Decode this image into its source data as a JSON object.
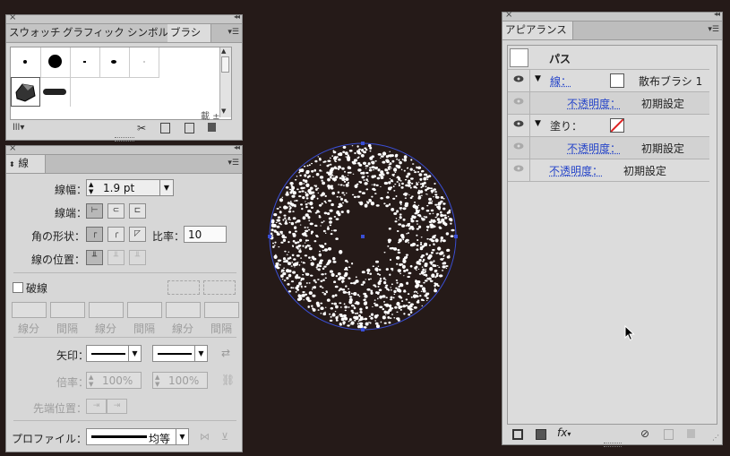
{
  "brush_panel": {
    "tabs": [
      "スウォッチ",
      "グラフィック",
      "シンボル",
      "ブラシ"
    ],
    "active_tab": "ブラシ",
    "partial_label": "載 ±"
  },
  "stroke_panel": {
    "tab": "線",
    "weight_label": "線幅：",
    "weight_value": "1.9 pt",
    "cap_label": "線端：",
    "corner_label": "角の形状：",
    "ratio_label": "比率：",
    "ratio_value": "10",
    "align_label": "線の位置：",
    "dashed_label": "破線",
    "dash_gap_labels": [
      "線分",
      "間隔",
      "線分",
      "間隔",
      "線分",
      "間隔"
    ],
    "arrow_label": "矢印：",
    "scale_label": "倍率：",
    "scale_value_1": "100%",
    "scale_value_2": "100%",
    "tip_label": "先端位置：",
    "profile_label": "プロファイル：",
    "profile_value": "均等"
  },
  "appearance_panel": {
    "tab": "アピアランス",
    "object_label": "パス",
    "rows": [
      {
        "name": "線：",
        "value": "散布ブラシ 1"
      },
      {
        "name": "不透明度：",
        "value": "初期設定"
      },
      {
        "name": "塗り：",
        "value": ""
      },
      {
        "name": "不透明度：",
        "value": "初期設定"
      },
      {
        "name": "不透明度：",
        "value": "初期設定"
      }
    ],
    "fx_label": "fx"
  },
  "colors": {
    "canvas_bg": "#251a18",
    "selection": "#3a4fd6",
    "link_text": "#2746c9"
  }
}
